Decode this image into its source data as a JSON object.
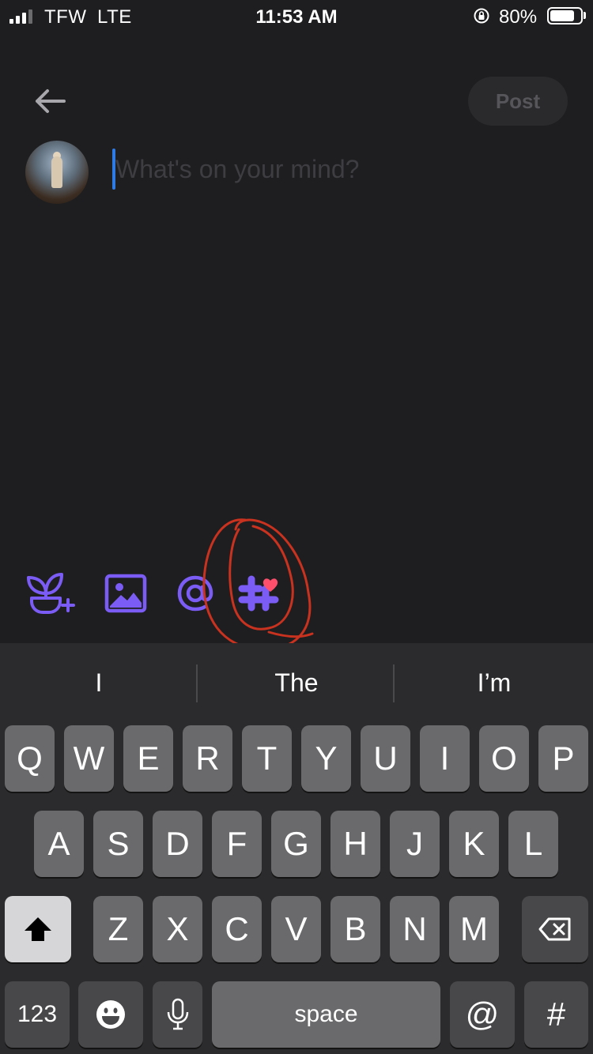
{
  "status_bar": {
    "carrier": "TFW",
    "network": "LTE",
    "time": "11:53 AM",
    "battery": "80%",
    "battery_level": 0.8
  },
  "header": {
    "back_icon": "arrow-left-icon",
    "post_label": "Post"
  },
  "composer": {
    "placeholder": "What's on your mind?",
    "value": ""
  },
  "toolbar": {
    "items": [
      "plant-add-icon",
      "image-icon",
      "mention-at-icon",
      "hashtag-heart-icon"
    ],
    "accent_color": "#7b5cf5",
    "heart_color": "#ff4f6d",
    "annotation_color": "#c8321f"
  },
  "keyboard": {
    "suggestions": [
      "I",
      "The",
      "I’m"
    ],
    "row1": [
      "Q",
      "W",
      "E",
      "R",
      "T",
      "Y",
      "U",
      "I",
      "O",
      "P"
    ],
    "row2": [
      "A",
      "S",
      "D",
      "F",
      "G",
      "H",
      "J",
      "K",
      "L"
    ],
    "row3": [
      "Z",
      "X",
      "C",
      "V",
      "B",
      "N",
      "M"
    ],
    "numbers_label": "123",
    "space_label": "space",
    "at_label": "@",
    "hash_label": "#"
  }
}
